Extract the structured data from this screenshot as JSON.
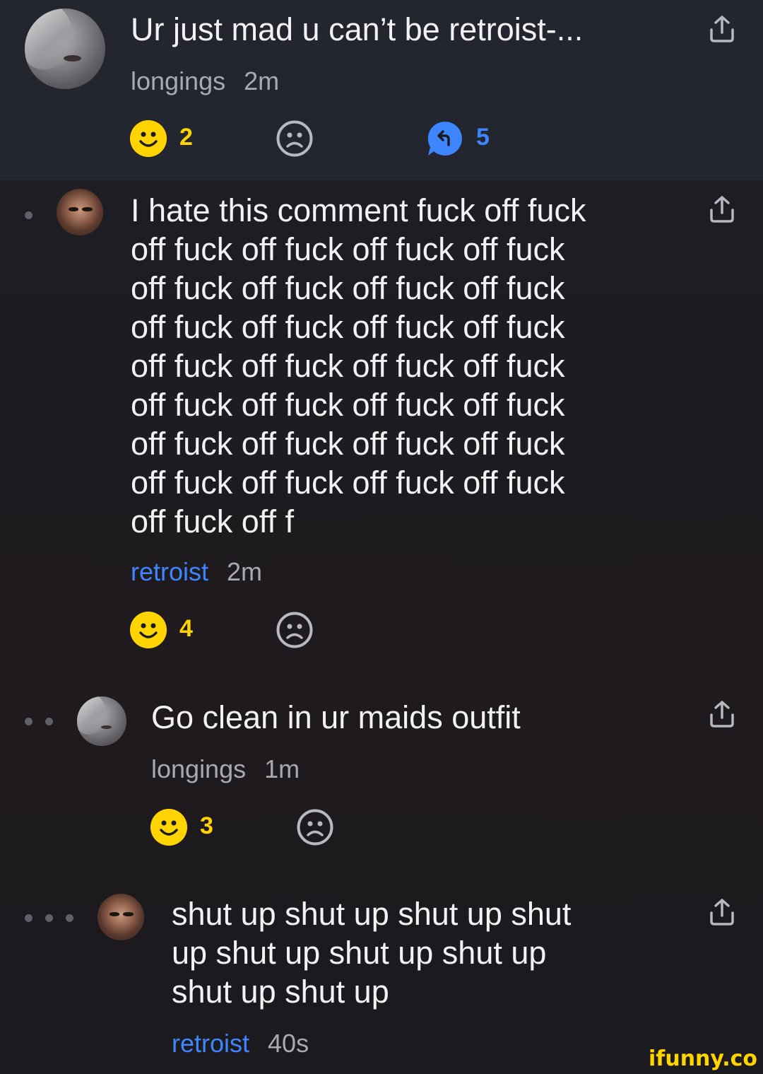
{
  "comments": [
    {
      "text": "Ur just mad u can’t be retroist-...",
      "username": "longings",
      "time": "2m",
      "smiles": "2",
      "replies": "5"
    },
    {
      "text": "I hate this comment fuck off fuck\noff fuck off fuck off fuck off fuck\noff fuck off fuck off fuck off fuck\noff fuck off fuck off fuck off fuck\noff fuck off fuck off fuck off fuck\noff fuck off fuck off fuck off fuck\noff fuck off fuck off fuck off fuck\noff fuck off fuck off fuck off fuck\noff fuck off f",
      "username": "retroist",
      "time": "2m",
      "smiles": "4"
    },
    {
      "text": "Go clean in ur maids outfit",
      "username": "longings",
      "time": "1m",
      "smiles": "3"
    },
    {
      "text": "shut up shut up shut up shut\nup shut up shut up shut up\nshut up shut up",
      "username": "retroist",
      "time": "40s"
    }
  ],
  "watermark": "ifunny.co",
  "colors": {
    "accent_blue": "#3e86ff",
    "smile_yellow": "#ffd400",
    "muted": "#a7a9b3"
  },
  "icons": [
    "share-icon",
    "smile-icon",
    "frown-icon",
    "reply-icon"
  ]
}
